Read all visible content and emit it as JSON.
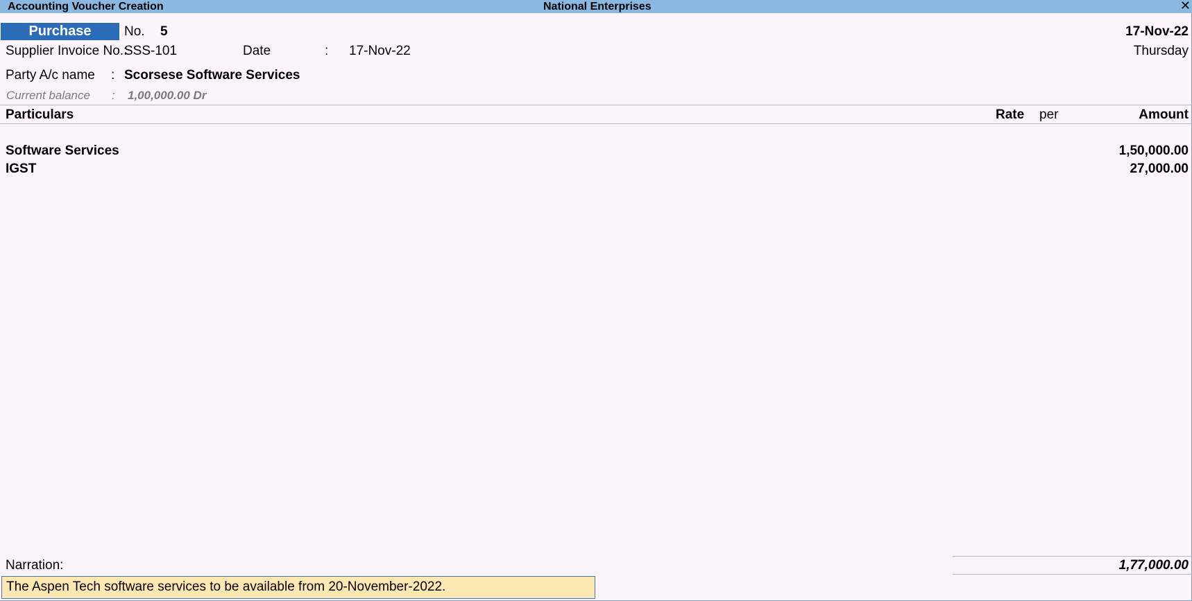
{
  "window": {
    "title": "Accounting Voucher Creation",
    "company": "National Enterprises",
    "close_icon": "✕"
  },
  "voucher": {
    "type": "Purchase",
    "no_label": "No.",
    "no_value": "5",
    "date": "17-Nov-22",
    "day": "Thursday",
    "supplier_invoice_label": "Supplier Invoice No.:",
    "supplier_invoice_value": "SSS-101",
    "invoice_date_label": "Date",
    "invoice_date_sep": ":",
    "invoice_date_value": "17-Nov-22",
    "party_label": "Party A/c name",
    "party_sep": ":",
    "party_value": "Scorsese Software Services",
    "balance_label": "Current balance",
    "balance_sep": ":",
    "balance_value": "1,00,000.00 Dr"
  },
  "table": {
    "headers": {
      "particulars": "Particulars",
      "rate": "Rate",
      "per": "per",
      "amount": "Amount"
    },
    "rows": [
      {
        "particular": "Software Services",
        "amount": "1,50,000.00"
      },
      {
        "particular": "IGST",
        "amount": "27,000.00"
      }
    ],
    "total": "1,77,000.00"
  },
  "narration": {
    "label": "Narration:",
    "text": "The Aspen Tech software services to be available from 20-November-2022."
  },
  "colors": {
    "background": "#fdf3fb",
    "titlebar": "#8ab8e0",
    "voucher_type_bg": "#2b6cb9",
    "narration_bg": "#fde8b2"
  }
}
